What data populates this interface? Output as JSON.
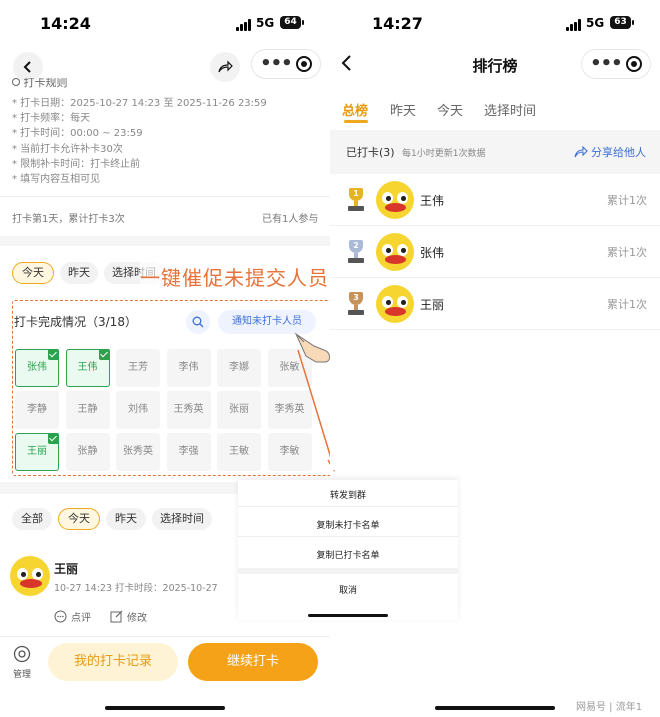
{
  "left": {
    "status": {
      "time": "14:24",
      "network": "5G",
      "battery": "64"
    },
    "partial_heading": "打卡规则",
    "rules": [
      "* 打卡日期：2025-10-27 14:23 至 2025-11-26 23:59",
      "* 打卡频率：每天",
      "* 打卡时间：00:00 ~ 23:59",
      "* 当前打卡允许补卡30次",
      "* 限制补卡时间：打卡终止前",
      "* 填写内容互相可见"
    ],
    "summary": "打卡第1天，累计打卡3次",
    "participants": "已有1人参与",
    "date_tabs": [
      "今天",
      "昨天",
      "选择时间"
    ],
    "annotation": "一键催促未提交人员",
    "completion_title": "打卡完成情况（3/18）",
    "notify_button": "通知未打卡人员",
    "members": [
      {
        "name": "张伟",
        "done": true
      },
      {
        "name": "王伟",
        "done": true
      },
      {
        "name": "王芳",
        "done": false
      },
      {
        "name": "李伟",
        "done": false
      },
      {
        "name": "李娜",
        "done": false
      },
      {
        "name": "张敏",
        "done": false
      },
      {
        "name": "李静",
        "done": false
      },
      {
        "name": "王静",
        "done": false
      },
      {
        "name": "刘伟",
        "done": false
      },
      {
        "name": "王秀英",
        "done": false
      },
      {
        "name": "张丽",
        "done": false
      },
      {
        "name": "李秀英",
        "done": false
      },
      {
        "name": "王丽",
        "done": true
      },
      {
        "name": "张静",
        "done": false
      },
      {
        "name": "张秀英",
        "done": false
      },
      {
        "name": "李强",
        "done": false
      },
      {
        "name": "王敏",
        "done": false
      },
      {
        "name": "李敏",
        "done": false
      }
    ],
    "filter_tabs": [
      "全部",
      "今天",
      "昨天",
      "选择时间"
    ],
    "record": {
      "name": "王丽",
      "meta": "10-27 14:23 打卡时段：2025-10-27",
      "comment": "点评",
      "edit": "修改"
    },
    "bottom": {
      "manage": "管理",
      "my_records": "我的打卡记录",
      "continue": "继续打卡"
    }
  },
  "sheet": {
    "items": [
      "转发到群",
      "复制未打卡名单",
      "复制已打卡名单"
    ],
    "cancel": "取消"
  },
  "right": {
    "status": {
      "time": "14:27",
      "network": "5G",
      "battery": "63"
    },
    "title": "排行榜",
    "tabs": [
      "总榜",
      "昨天",
      "今天",
      "选择时间"
    ],
    "active_tab": "总榜",
    "checked_count": "已打卡(3)",
    "update_note": "每1小时更新1次数据",
    "share": "分享给他人",
    "ranks": [
      {
        "rank": "1",
        "name": "王伟",
        "total": "累计1次",
        "color": "#e6b422"
      },
      {
        "rank": "2",
        "name": "张伟",
        "total": "累计1次",
        "color": "#a9b9d6"
      },
      {
        "rank": "3",
        "name": "王丽",
        "total": "累计1次",
        "color": "#c8935a"
      }
    ]
  },
  "watermark": "网易号 | 流年1",
  "colors": {
    "accent": "#f0a91e",
    "green": "#2ba24c",
    "annot": "#e8733a",
    "blue": "#3b6fd8"
  }
}
